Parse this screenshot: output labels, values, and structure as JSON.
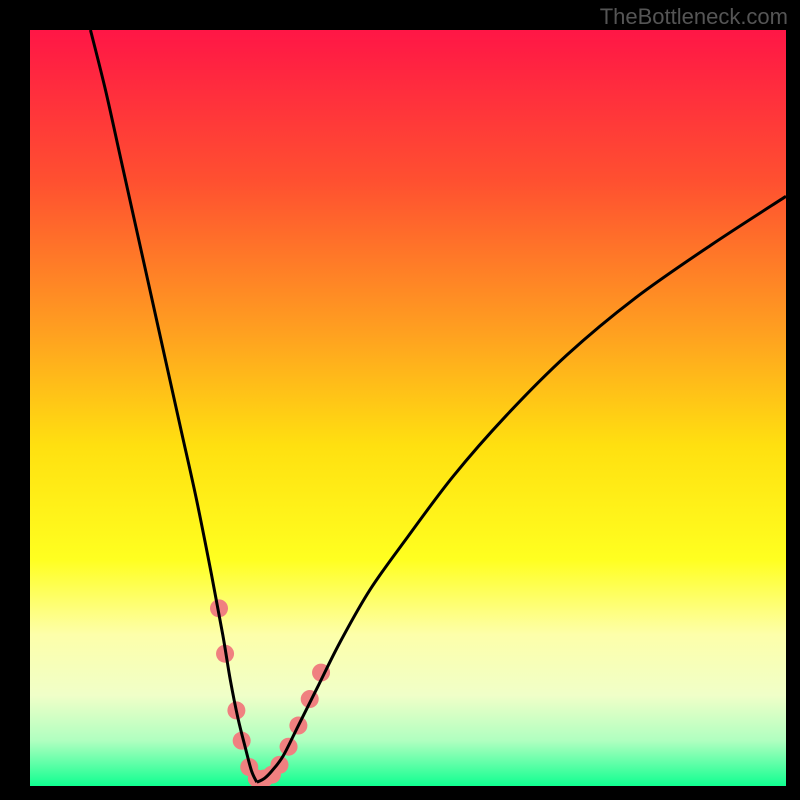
{
  "watermark": "TheBottleneck.com",
  "colors": {
    "frame": "#000000",
    "curve_stroke": "#000000",
    "dot_fill": "#f08080",
    "watermark_text": "#555555"
  },
  "chart_data": {
    "type": "line",
    "title": "",
    "xlabel": "",
    "ylabel": "",
    "xlim": [
      0,
      100
    ],
    "ylim": [
      0,
      100
    ],
    "gradient_stops": [
      {
        "pos": 0.0,
        "color": "#ff1646"
      },
      {
        "pos": 0.2,
        "color": "#ff5030"
      },
      {
        "pos": 0.4,
        "color": "#ffa020"
      },
      {
        "pos": 0.55,
        "color": "#ffe010"
      },
      {
        "pos": 0.7,
        "color": "#ffff20"
      },
      {
        "pos": 0.8,
        "color": "#fdffaa"
      },
      {
        "pos": 0.88,
        "color": "#f0ffc8"
      },
      {
        "pos": 0.94,
        "color": "#b0ffc0"
      },
      {
        "pos": 1.0,
        "color": "#10ff90"
      }
    ],
    "series": [
      {
        "name": "left-branch",
        "x": [
          8.0,
          10.0,
          12.0,
          14.0,
          16.0,
          18.0,
          20.0,
          22.0,
          24.0,
          25.5,
          26.5,
          27.5,
          28.5,
          29.3,
          30.0
        ],
        "y": [
          100,
          92,
          83,
          74,
          65,
          56,
          47,
          38,
          28,
          20,
          14,
          9,
          5,
          2,
          0.5
        ]
      },
      {
        "name": "right-branch",
        "x": [
          30.0,
          31.0,
          32.0,
          33.5,
          35.5,
          38.0,
          41.0,
          45.0,
          50.0,
          56.0,
          63.0,
          71.0,
          80.0,
          90.0,
          100.0
        ],
        "y": [
          0.5,
          1.0,
          2.0,
          4.0,
          8.0,
          13.0,
          19.0,
          26.0,
          33.0,
          41.0,
          49.0,
          57.0,
          64.5,
          71.5,
          78.0
        ]
      }
    ],
    "dots": {
      "name": "highlight-dots",
      "points": [
        {
          "x": 25.0,
          "y": 23.5
        },
        {
          "x": 25.8,
          "y": 17.5
        },
        {
          "x": 27.3,
          "y": 10.0
        },
        {
          "x": 28.0,
          "y": 6.0
        },
        {
          "x": 29.0,
          "y": 2.5
        },
        {
          "x": 30.0,
          "y": 1.0
        },
        {
          "x": 31.0,
          "y": 1.0
        },
        {
          "x": 32.0,
          "y": 1.5
        },
        {
          "x": 33.0,
          "y": 2.8
        },
        {
          "x": 34.2,
          "y": 5.2
        },
        {
          "x": 35.5,
          "y": 8.0
        },
        {
          "x": 37.0,
          "y": 11.5
        },
        {
          "x": 38.5,
          "y": 15.0
        }
      ],
      "radius": 9
    }
  }
}
